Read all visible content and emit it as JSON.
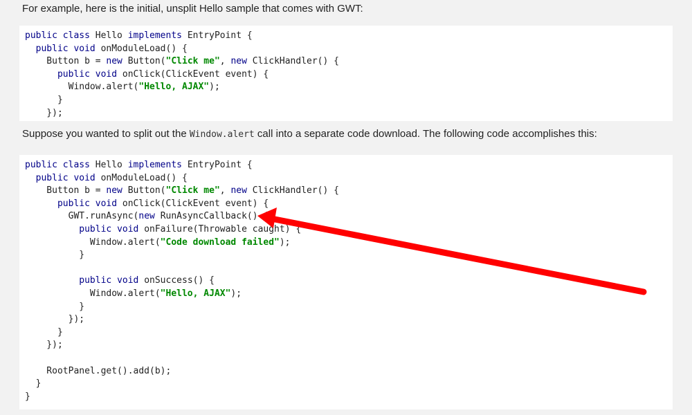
{
  "intro": {
    "text": "For example, here is the initial, unsplit Hello sample that comes with GWT:"
  },
  "code1": {
    "lines": [
      [
        {
          "t": "public class ",
          "k": "kw"
        },
        {
          "t": "Hello "
        },
        {
          "t": "implements ",
          "k": "kw"
        },
        {
          "t": "EntryPoint {"
        }
      ],
      [
        {
          "t": "  "
        },
        {
          "t": "public void ",
          "k": "kw"
        },
        {
          "t": "onModuleLoad() {"
        }
      ],
      [
        {
          "t": "    Button b = "
        },
        {
          "t": "new ",
          "k": "kw"
        },
        {
          "t": "Button("
        },
        {
          "t": "\"Click me\"",
          "k": "str"
        },
        {
          "t": ", "
        },
        {
          "t": "new ",
          "k": "kw"
        },
        {
          "t": "ClickHandler() {"
        }
      ],
      [
        {
          "t": "      "
        },
        {
          "t": "public void ",
          "k": "kw"
        },
        {
          "t": "onClick(ClickEvent event) {"
        }
      ],
      [
        {
          "t": "        Window.alert("
        },
        {
          "t": "\"Hello, AJAX\"",
          "k": "str"
        },
        {
          "t": ");"
        }
      ],
      [
        {
          "t": "      }"
        }
      ],
      [
        {
          "t": "    });"
        }
      ]
    ]
  },
  "middle": {
    "before": "Suppose you wanted to split out the ",
    "code": "Window.alert",
    "after": " call into a separate code download. The following code accomplishes this:"
  },
  "code2": {
    "lines": [
      [
        {
          "t": "public class ",
          "k": "kw"
        },
        {
          "t": "Hello "
        },
        {
          "t": "implements ",
          "k": "kw"
        },
        {
          "t": "EntryPoint {"
        }
      ],
      [
        {
          "t": "  "
        },
        {
          "t": "public void ",
          "k": "kw"
        },
        {
          "t": "onModuleLoad() {"
        }
      ],
      [
        {
          "t": "    Button b = "
        },
        {
          "t": "new ",
          "k": "kw"
        },
        {
          "t": "Button("
        },
        {
          "t": "\"Click me\"",
          "k": "str"
        },
        {
          "t": ", "
        },
        {
          "t": "new ",
          "k": "kw"
        },
        {
          "t": "ClickHandler() {"
        }
      ],
      [
        {
          "t": "      "
        },
        {
          "t": "public void ",
          "k": "kw"
        },
        {
          "t": "onClick(ClickEvent event) {"
        }
      ],
      [
        {
          "t": "        GWT.runAsync("
        },
        {
          "t": "new ",
          "k": "kw"
        },
        {
          "t": "RunAsyncCallback() {"
        }
      ],
      [
        {
          "t": "          "
        },
        {
          "t": "public void ",
          "k": "kw"
        },
        {
          "t": "onFailure(Throwable caught) {"
        }
      ],
      [
        {
          "t": "            Window.alert("
        },
        {
          "t": "\"Code download failed\"",
          "k": "str"
        },
        {
          "t": ");"
        }
      ],
      [
        {
          "t": "          }"
        }
      ],
      [
        {
          "t": ""
        }
      ],
      [
        {
          "t": "          "
        },
        {
          "t": "public void ",
          "k": "kw"
        },
        {
          "t": "onSuccess() {"
        }
      ],
      [
        {
          "t": "            Window.alert("
        },
        {
          "t": "\"Hello, AJAX\"",
          "k": "str"
        },
        {
          "t": ");"
        }
      ],
      [
        {
          "t": "          }"
        }
      ],
      [
        {
          "t": "        });"
        }
      ],
      [
        {
          "t": "      }"
        }
      ],
      [
        {
          "t": "    });"
        }
      ],
      [
        {
          "t": ""
        }
      ],
      [
        {
          "t": "    RootPanel.get().add(b);"
        }
      ],
      [
        {
          "t": "  }"
        }
      ],
      [
        {
          "t": "}"
        }
      ]
    ]
  },
  "colors": {
    "keyword": "#000088",
    "string": "#008800",
    "arrow": "#ff0000"
  },
  "annotation": {
    "icon": "red-arrow-icon"
  }
}
